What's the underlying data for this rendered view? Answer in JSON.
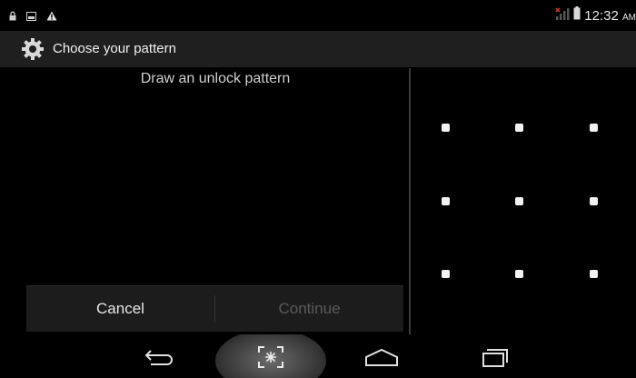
{
  "status_bar": {
    "time": "12:32",
    "ampm": "AM",
    "icons": [
      "lock-icon",
      "image-icon",
      "warning-icon",
      "signal-icon",
      "battery-icon"
    ]
  },
  "action_bar": {
    "icon": "settings-gear-icon",
    "title": "Choose your pattern"
  },
  "header": {
    "message": "Draw an unlock pattern"
  },
  "buttons": {
    "cancel": "Cancel",
    "continue": "Continue"
  },
  "pattern": {
    "grid": [
      3,
      3
    ],
    "dots": 9
  },
  "nav_bar": {
    "buttons": [
      "back-icon",
      "screenshot-icon",
      "home-icon",
      "recents-icon"
    ]
  },
  "colors": {
    "background": "#000000",
    "action_bar": "#1f1f1f",
    "button_bar": "#1c1c1c",
    "text_primary": "#e6e6e6",
    "text_disabled": "#5a5a5a",
    "signal_alert": "#d03a2a"
  }
}
